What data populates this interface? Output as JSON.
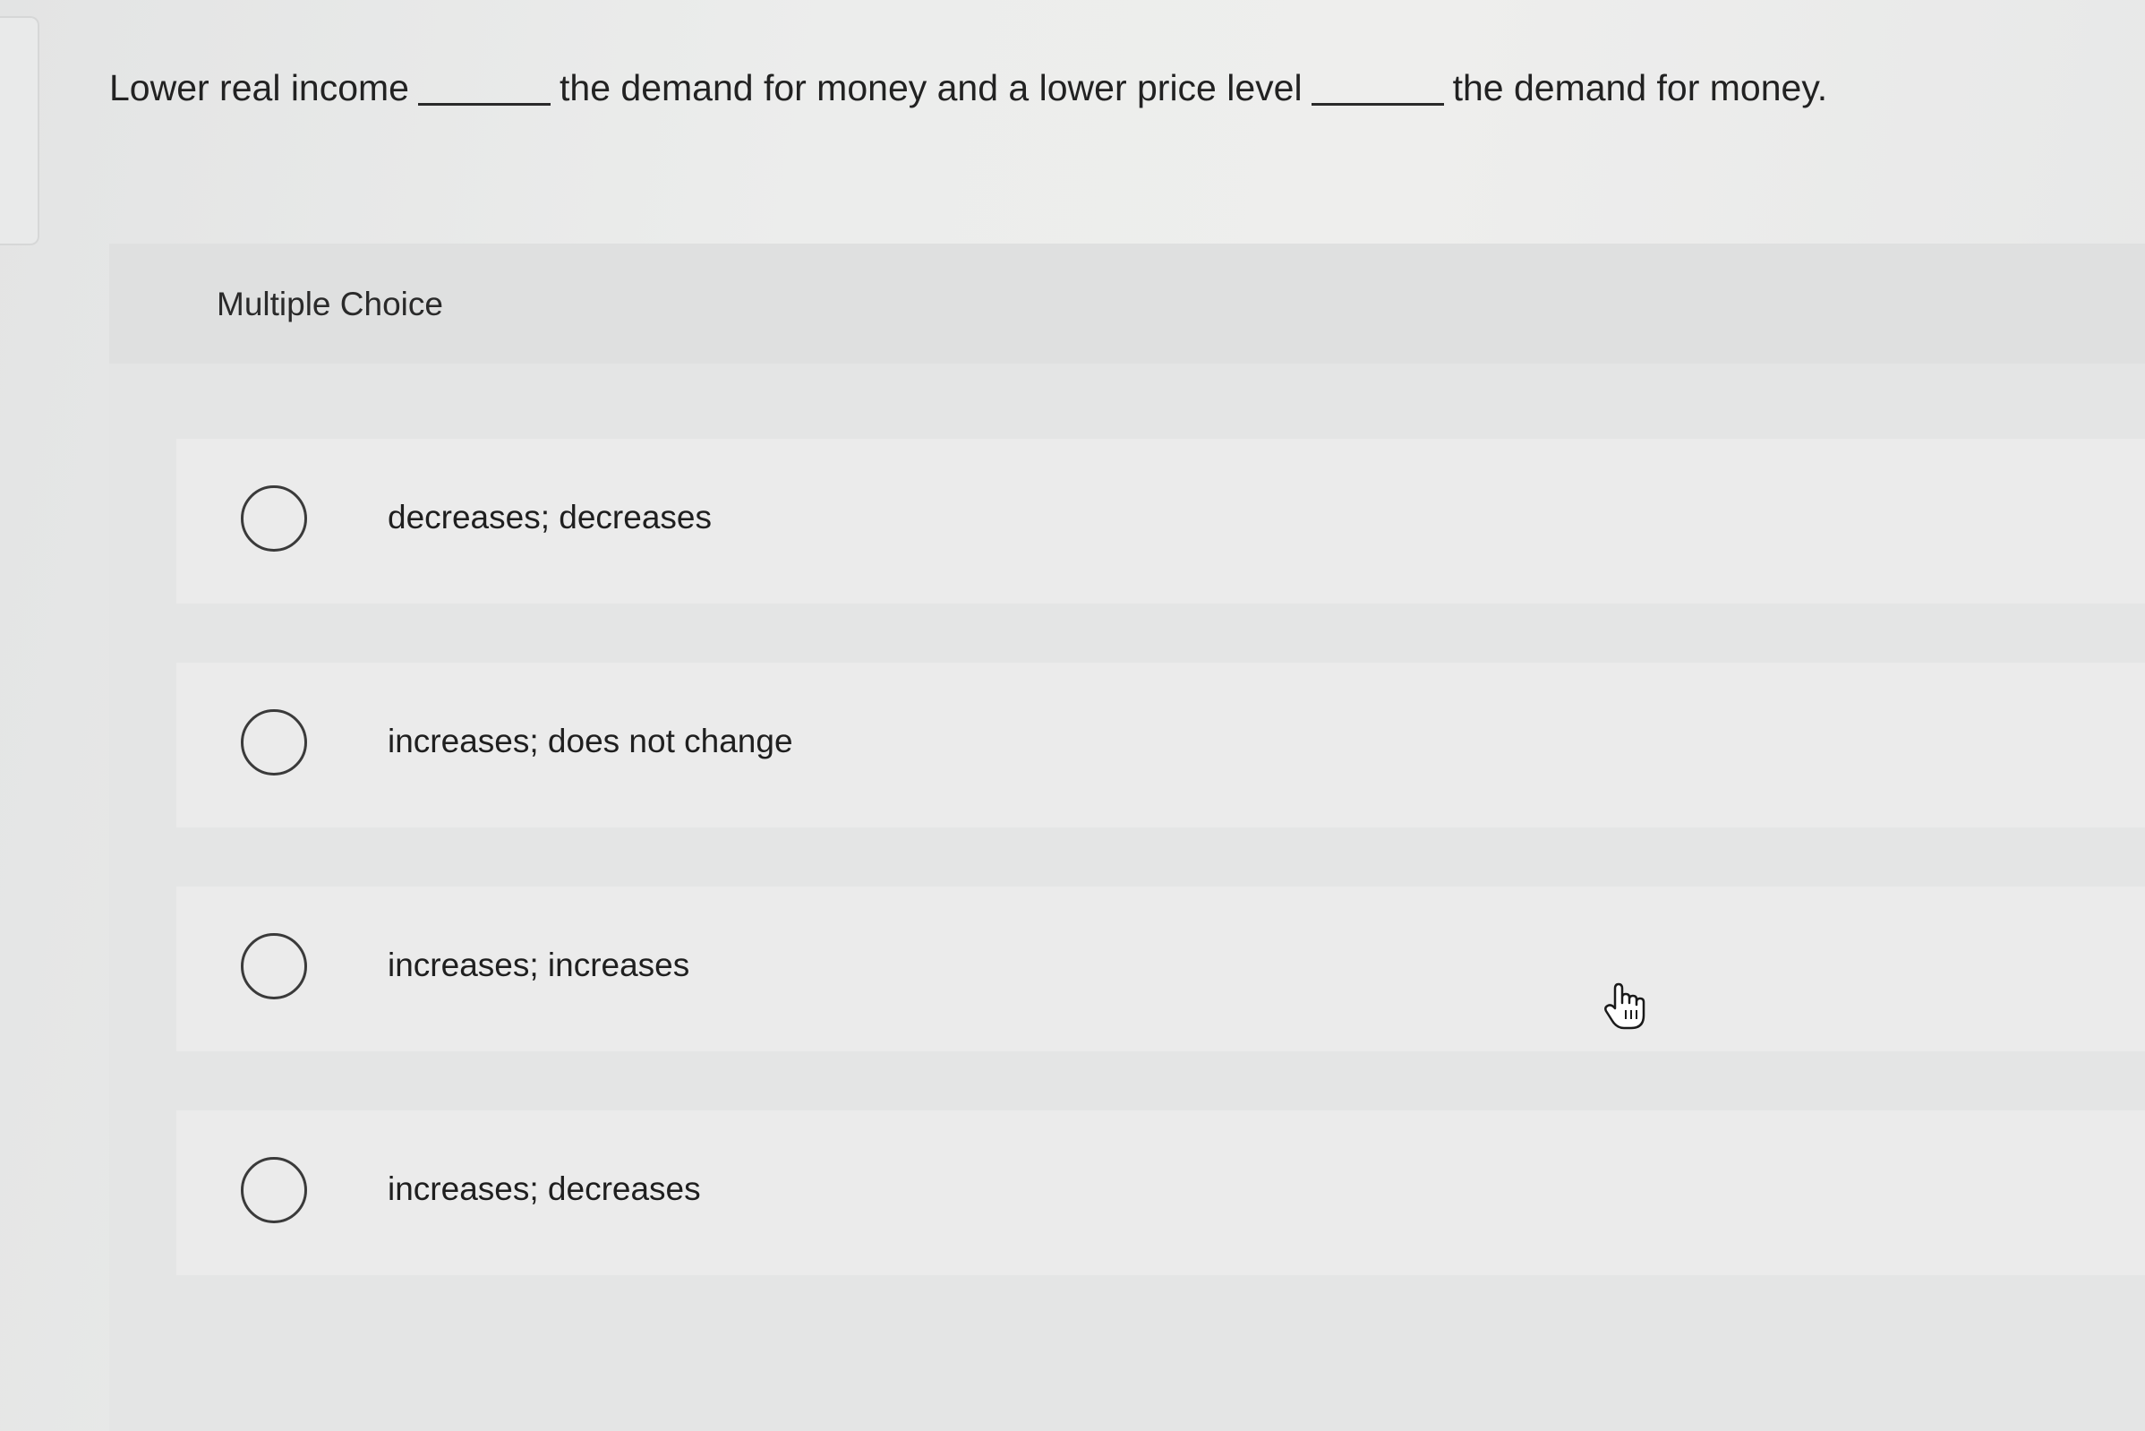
{
  "question": {
    "part1": "Lower real income",
    "part2": "the demand for money and a lower price level",
    "part3": "the demand for money."
  },
  "panel": {
    "title": "Multiple Choice"
  },
  "options": [
    {
      "label": "decreases; decreases"
    },
    {
      "label": "increases; does not change"
    },
    {
      "label": "increases; increases"
    },
    {
      "label": "increases; decreases"
    }
  ],
  "icons": {
    "radio": "radio-icon",
    "cursor": "hand-pointer-icon"
  },
  "colors": {
    "background": "#e7e8e8",
    "panel": "#e4e5e5",
    "option_bg": "#ebebeb",
    "text": "#1f1f1f"
  }
}
